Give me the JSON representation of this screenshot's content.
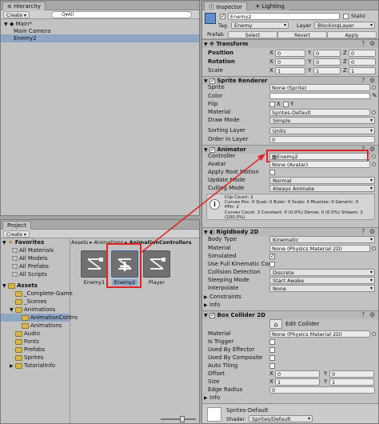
{
  "hierarchy": {
    "tab": "Hierarchy",
    "create": "Create ▾",
    "search": "Q▾All",
    "scene": "Main*",
    "items": [
      "Main Camera",
      "Enemy2"
    ]
  },
  "project": {
    "tab": "Project",
    "create": "Create ▾",
    "favorites_label": "Favorites",
    "favorites": [
      "All Materials",
      "All Models",
      "All Prefabs",
      "All Scripts"
    ],
    "assets_label": "Assets",
    "tree": [
      "_Complete-Game",
      "_Scenes",
      "Animations",
      "AnimationContro",
      "Animations",
      "Audio",
      "Fonts",
      "Prefabs",
      "Sprites",
      "TutorialInfo"
    ],
    "breadcrumb": [
      "Assets",
      "Animations",
      "AnimationControllers"
    ],
    "assets": [
      {
        "name": "Enemy1",
        "selected": false
      },
      {
        "name": "Enemy2",
        "selected": true
      },
      {
        "name": "Player",
        "selected": false
      }
    ]
  },
  "inspector": {
    "tabs": [
      "Inspector",
      "Lighting"
    ],
    "object_name": "Enemy2",
    "static_label": "Static",
    "tag_label": "Tag",
    "tag_value": "Enemy",
    "layer_label": "Layer",
    "layer_value": "BlockingLayer",
    "prefab_label": "Prefab",
    "prefab_buttons": [
      "Select",
      "Revert",
      "Apply"
    ],
    "transform": {
      "title": "Transform",
      "rows": [
        {
          "label": "Position",
          "x": "0",
          "y": "0",
          "z": "0"
        },
        {
          "label": "Rotation",
          "x": "0",
          "y": "0",
          "z": "0"
        },
        {
          "label": "Scale",
          "x": "1",
          "y": "1",
          "z": "1"
        }
      ]
    },
    "sprite_renderer": {
      "title": "Sprite Renderer",
      "sprite_label": "Sprite",
      "sprite_value": "None (Sprite)",
      "color_label": "Color",
      "flip_label": "Flip",
      "flip_x": "X",
      "flip_y": "Y",
      "material_label": "Material",
      "material_value": "Sprites-Default",
      "draw_label": "Draw Mode",
      "draw_value": "Simple",
      "sorting_label": "Sorting Layer",
      "sorting_value": "Units",
      "order_label": "Order in Layer",
      "order_value": "0"
    },
    "animator": {
      "title": "Animator",
      "controller_label": "Controller",
      "controller_value": "Enemy2",
      "avatar_label": "Avatar",
      "avatar_value": "None (Avatar)",
      "root_label": "Apply Root Motion",
      "update_label": "Update Mode",
      "update_value": "Normal",
      "culling_label": "Culling Mode",
      "culling_value": "Always Animate",
      "info": [
        "Clip Count: 2",
        "Curves Pos: 0 Quat: 0 Euler: 0 Scale: 0 Muscles: 0 Generic: 0",
        "PPtr: 2",
        "Curves Count: 2 Constant: 0 (0.0%) Dense: 0 (0.0%) Stream: 2",
        "(100.0%)"
      ]
    },
    "rigidbody": {
      "title": "Rigidbody 2D",
      "rows": [
        {
          "label": "Body Type",
          "value": "Kinematic",
          "kind": "dropdown"
        },
        {
          "label": "Material",
          "value": "None (Physics Material 2D)",
          "kind": "field"
        },
        {
          "label": "Simulated",
          "value": "",
          "kind": "check-on"
        },
        {
          "label": "Use Full Kinematic Cont",
          "value": "",
          "kind": "check"
        },
        {
          "label": "Collision Detection",
          "value": "Discrete",
          "kind": "dropdown"
        },
        {
          "label": "Sleeping Mode",
          "value": "Start Awake",
          "kind": "dropdown"
        },
        {
          "label": "Interpolate",
          "value": "None",
          "kind": "dropdown"
        }
      ],
      "constraints": "Constraints",
      "info": "Info"
    },
    "box_collider": {
      "title": "Box Collider 2D",
      "edit": "Edit Collider",
      "rows": [
        {
          "label": "Material",
          "value": "None (Physics Material 2D)",
          "kind": "field"
        },
        {
          "label": "Is Trigger",
          "value": "",
          "kind": "check"
        },
        {
          "label": "Used By Effector",
          "value": "",
          "kind": "check"
        },
        {
          "label": "Used By Composite",
          "value": "",
          "kind": "check"
        },
        {
          "label": "Auto Tiling",
          "value": "",
          "kind": "check"
        }
      ],
      "offset_label": "Offset",
      "offset_x": "0",
      "offset_y": "0",
      "size_label": "Size",
      "size_x": "1",
      "size_y": "1",
      "edge_label": "Edge Radius",
      "edge_value": "0",
      "info": "Info"
    },
    "material_footer": {
      "name": "Sprites-Default",
      "shader_label": "Shader",
      "shader_value": "Sprites/Default"
    }
  },
  "colors": {
    "highlight": "#e02424",
    "selection": "#8fa5c4",
    "folder": "#d8b64a"
  }
}
